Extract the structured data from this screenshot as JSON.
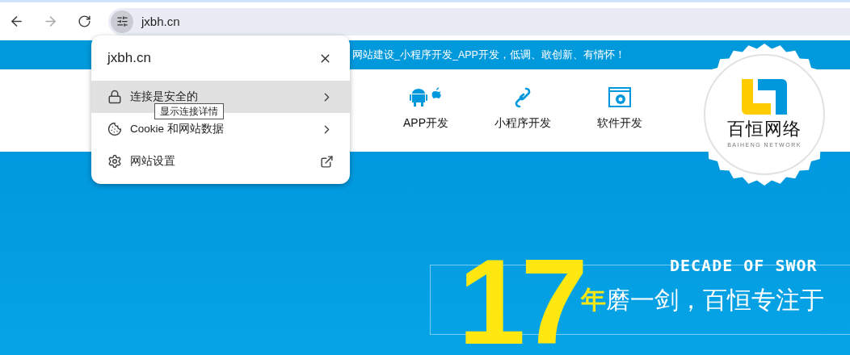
{
  "browser": {
    "address": "jxbh.cn"
  },
  "site_popup": {
    "title": "jxbh.cn",
    "tooltip": "显示连接详情",
    "items": [
      {
        "kind": "link",
        "label": "连接是安全的",
        "selected": true
      },
      {
        "kind": "link",
        "label": "Cookie 和网站数据",
        "selected": false
      },
      {
        "kind": "external",
        "label": "网站设置",
        "selected": false
      }
    ]
  },
  "site": {
    "top_banner": "网站建设_小程序开发_APP开发，低调、敢创新、有情怀！",
    "nav": [
      {
        "label": "APP开发"
      },
      {
        "label": "小程序开发"
      },
      {
        "label": "软件开发"
      }
    ],
    "logo": {
      "name": "百恒网络",
      "subtitle": "BAIHENG NETWORK"
    },
    "hero": {
      "number": "17",
      "tagline_en": "DECADE OF SWOR",
      "tagline_lead": "年",
      "tagline": "磨一剑，百恒专注于"
    }
  }
}
